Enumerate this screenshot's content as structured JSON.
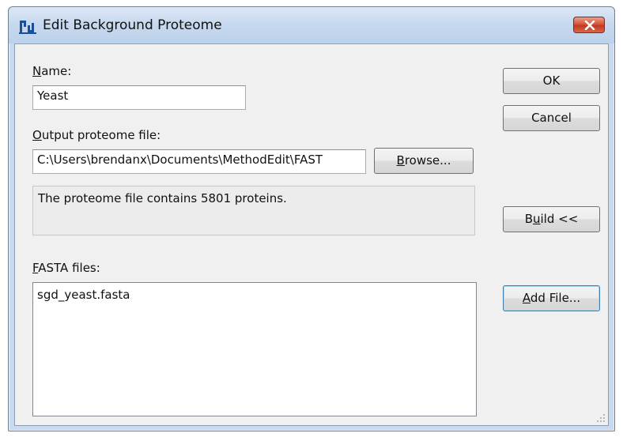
{
  "window": {
    "title": "Edit Background Proteome",
    "icon": "skyline-app-icon",
    "close_icon": "close-icon"
  },
  "name_field": {
    "label_mnemonic": "N",
    "label_rest": "ame:",
    "value": "Yeast"
  },
  "output_file": {
    "label_mnemonic": "O",
    "label_rest": "utput proteome file:",
    "value": "C:\\Users\\brendanx\\Documents\\MethodEdit\\FAST",
    "browse_mnemonic": "B",
    "browse_rest": "rowse..."
  },
  "status": {
    "message": "The proteome file contains 5801 proteins."
  },
  "fasta": {
    "label_mnemonic": "F",
    "label_rest": "ASTA files:",
    "files": [
      "sgd_yeast.fasta"
    ]
  },
  "buttons": {
    "ok": "OK",
    "cancel": "Cancel",
    "build_pre": "B",
    "build_mnemonic": "u",
    "build_post": "ild <<",
    "addfile_mnemonic": "A",
    "addfile_rest": "dd File..."
  },
  "colors": {
    "client_background": "#f0f0f0",
    "title_bar": "#c6d8ee",
    "close_button": "#c23a20",
    "focus_border": "#3c7fb1"
  }
}
